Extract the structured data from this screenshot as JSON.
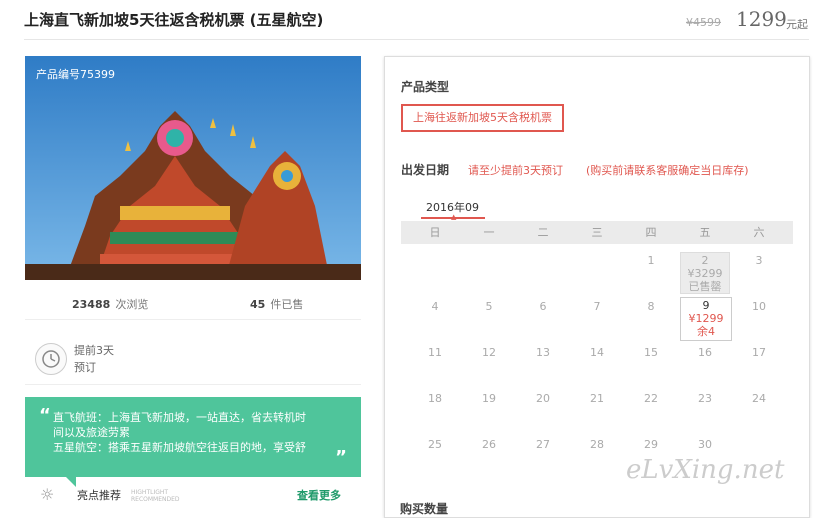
{
  "header": {
    "title": "上海直飞新加坡5天往返含税机票 (五星航空)",
    "old_price": "¥4599",
    "price": "1299",
    "price_suffix": "元起"
  },
  "product": {
    "code_label": "产品编号75399",
    "views_count": "23488",
    "views_label": "次浏览",
    "sold_count": "45",
    "sold_label": "件已售",
    "advance_line1": "提前3天",
    "advance_line2": "预订"
  },
  "highlight": {
    "text_line1": "直飞航班：上海直飞新加坡，一站直达，省去转机时",
    "text_line2": "间以及旅途劳累",
    "text_line3": "五星航空：搭乘五星新加坡航空往返目的地，享受舒",
    "quote_open": "“",
    "quote_close": "”",
    "label": "亮点推荐",
    "label_en_1": "HIGHTLIGHT",
    "label_en_2": "RECOMMENDED",
    "more_link": "查看更多"
  },
  "booking": {
    "product_type_label": "产品类型",
    "product_type_option": "上海往返新加坡5天含税机票",
    "departure_label": "出发日期",
    "warning_1": "请至少提前3天预订",
    "warning_2": "(购买前请联系客服确定当日库存)",
    "month": "2016年09",
    "weekdays": [
      "日",
      "一",
      "二",
      "三",
      "四",
      "五",
      "六"
    ],
    "row1": [
      "1",
      "3"
    ],
    "soldout_cell": {
      "day": "2",
      "price": "¥3299",
      "status": "已售罄"
    },
    "row2": [
      "4",
      "5",
      "6",
      "7",
      "8",
      "10"
    ],
    "avail_cell": {
      "day": "9",
      "price": "¥1299",
      "remain": "余4"
    },
    "row3": [
      "11",
      "12",
      "13",
      "14",
      "15",
      "16",
      "17"
    ],
    "row4": [
      "18",
      "19",
      "20",
      "21",
      "22",
      "23",
      "24"
    ],
    "row5": [
      "25",
      "26",
      "27",
      "28",
      "29",
      "30"
    ],
    "buy_count_label": "购买数量"
  },
  "watermark": "eLvXing.net",
  "colors": {
    "accent_red": "#e0574f",
    "accent_green": "#4fc59b",
    "link_green": "#1f9a6a"
  }
}
